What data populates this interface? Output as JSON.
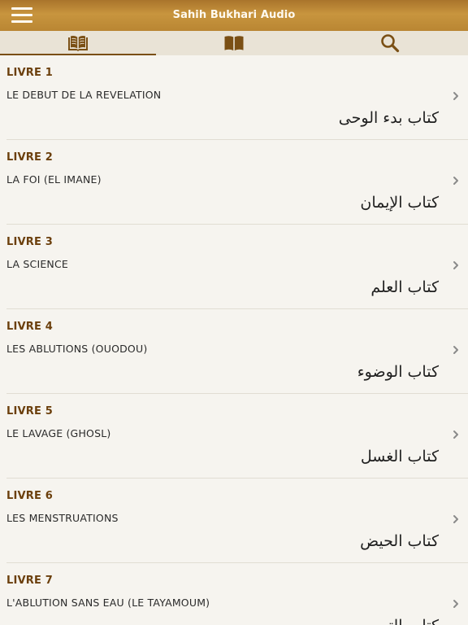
{
  "header": {
    "title": "Sahih Bukhari Audio",
    "menu_icon": "hamburger-menu-icon"
  },
  "tabs": [
    {
      "icon": "open-book-icon",
      "active": true
    },
    {
      "icon": "book-icon",
      "active": false
    },
    {
      "icon": "search-icon",
      "active": false
    }
  ],
  "colors": {
    "header": "#b98633",
    "tab_icon": "#7a4f14",
    "book_number": "#6b3f0c",
    "background": "#f6f4ef"
  },
  "books": [
    {
      "number": "LIVRE 1",
      "title_fr": "LE DEBUT DE LA REVELATION",
      "title_ar": "كتاب بدء الوحى"
    },
    {
      "number": "LIVRE 2",
      "title_fr": "LA FOI (EL IMANE)",
      "title_ar": "كتاب الإيمان"
    },
    {
      "number": "LIVRE 3",
      "title_fr": "LA SCIENCE",
      "title_ar": "كتاب العلم"
    },
    {
      "number": "LIVRE 4",
      "title_fr": "LES ABLUTIONS (OUODOU)",
      "title_ar": "كتاب الوضوء"
    },
    {
      "number": "LIVRE 5",
      "title_fr": "LE LAVAGE (GHOSL)",
      "title_ar": "كتاب الغسل"
    },
    {
      "number": "LIVRE 6",
      "title_fr": "LES MENSTRUATIONS",
      "title_ar": "كتاب الحيض"
    },
    {
      "number": "LIVRE 7",
      "title_fr": "L'ABLUTION SANS EAU (LE TAYAMOUM)",
      "title_ar": "كتاب التيمم"
    }
  ]
}
